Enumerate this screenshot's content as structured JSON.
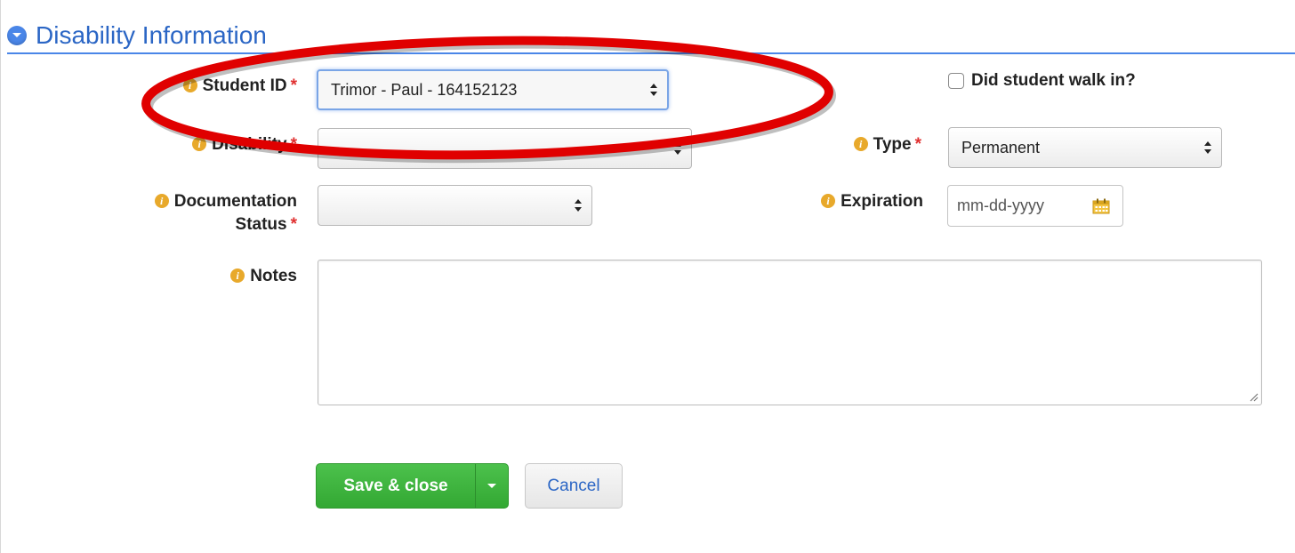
{
  "section": {
    "title": "Disability Information"
  },
  "form": {
    "student_id": {
      "label": "Student ID",
      "required_mark": "*",
      "value": "Trimor - Paul - 164152123"
    },
    "walk_in": {
      "label": "Did student walk in?",
      "checked": false
    },
    "disability": {
      "label": "Disability",
      "required_mark": "*",
      "value": ""
    },
    "type": {
      "label": "Type",
      "required_mark": "*",
      "value": "Permanent"
    },
    "documentation_status": {
      "label_line1": "Documentation",
      "label_line2": "Status",
      "required_mark": "*",
      "value": ""
    },
    "expiration": {
      "label": "Expiration",
      "placeholder": "mm-dd-yyyy"
    },
    "notes": {
      "label": "Notes",
      "value": ""
    }
  },
  "buttons": {
    "save_close": "Save & close",
    "cancel": "Cancel"
  },
  "colors": {
    "accent": "#4a86e8",
    "title": "#2b66c5",
    "info_icon": "#e8a92b",
    "required": "#e03030",
    "save_button": "#3cb33c",
    "annotation": "#e00000"
  },
  "icons": {
    "section_toggle": "chevron-down-icon",
    "field_info": "info-icon",
    "select_arrows": "updown-arrows-icon",
    "date_picker": "calendar-icon",
    "dropdown": "caret-down-icon",
    "resize": "resize-grip-icon"
  }
}
